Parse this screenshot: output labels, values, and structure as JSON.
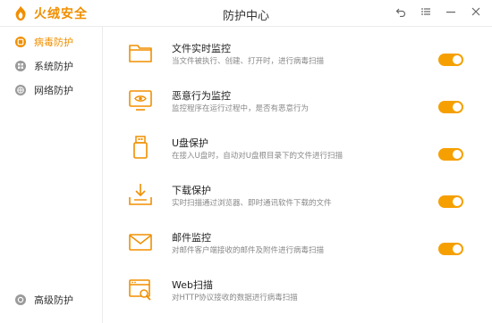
{
  "app": {
    "brand_name": "火绒安全",
    "title": "防护中心",
    "accent_color": "#f5a000",
    "window_controls": [
      {
        "name": "back-icon",
        "glyph": "↶"
      },
      {
        "name": "menu-icon",
        "glyph": "☰"
      },
      {
        "name": "minimize-icon",
        "glyph": "—"
      },
      {
        "name": "close-icon",
        "glyph": "✕"
      }
    ]
  },
  "sidebar": {
    "items": [
      {
        "label": "病毒防护",
        "icon": "virus-shield-icon",
        "active": true
      },
      {
        "label": "系统防护",
        "icon": "system-grid-icon",
        "active": false
      },
      {
        "label": "网络防护",
        "icon": "globe-icon",
        "active": false
      }
    ],
    "bottom_item": {
      "label": "高级防护",
      "icon": "advanced-icon"
    }
  },
  "protections": [
    {
      "title": "文件实时监控",
      "desc": "当文件被执行、创建、打开时，进行病毒扫描",
      "icon": "folder-icon",
      "enabled": true
    },
    {
      "title": "恶意行为监控",
      "desc": "监控程序在运行过程中，是否有恶意行为",
      "icon": "monitor-eye-icon",
      "enabled": true
    },
    {
      "title": "U盘保护",
      "desc": "在接入U盘时，自动对U盘根目录下的文件进行扫描",
      "icon": "usb-drive-icon",
      "enabled": true
    },
    {
      "title": "下载保护",
      "desc": "实时扫描通过浏览器、即时通讯软件下载的文件",
      "icon": "download-tray-icon",
      "enabled": true
    },
    {
      "title": "邮件监控",
      "desc": "对邮件客户端接收的邮件及附件进行病毒扫描",
      "icon": "mail-icon",
      "enabled": true
    },
    {
      "title": "Web扫描",
      "desc": "对HTTP协议接收的数据进行病毒扫描",
      "icon": "web-scan-icon",
      "enabled": false
    }
  ]
}
